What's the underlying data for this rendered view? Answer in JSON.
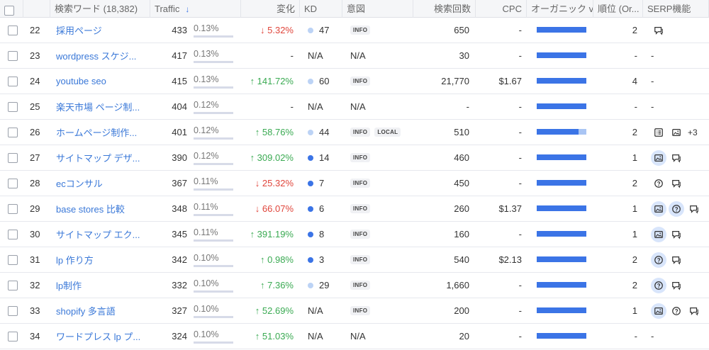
{
  "header": {
    "keyword": "検索ワード (18,382)",
    "traffic": "Traffic",
    "change": "変化",
    "kd": "KD",
    "intent": "意図",
    "volume": "検索回数",
    "cpc": "CPC",
    "organic": "オーガニック vs ",
    "position": "順位 (Or...",
    "serp": "SERP機能"
  },
  "rows": [
    {
      "num": "22",
      "keyword": "採用ページ",
      "traffic": "433",
      "share": "0.13%",
      "change": "↓ 5.32%",
      "dir": "dn",
      "kd_dot": "l",
      "kd": "47",
      "intent": [
        "INFO"
      ],
      "volume": "650",
      "cpc": "-",
      "organic": "full",
      "position": "2",
      "serp": [
        {
          "icon": "chat-icon",
          "hl": false
        }
      ],
      "more": ""
    },
    {
      "num": "23",
      "keyword": "wordpress スケジ...",
      "traffic": "417",
      "share": "0.13%",
      "change": "-",
      "dir": "",
      "kd_dot": "",
      "kd": "N/A",
      "intent_text": "N/A",
      "intent": [],
      "volume": "30",
      "cpc": "-",
      "organic": "full",
      "position": "-",
      "serp": [],
      "serp_text": "-",
      "more": ""
    },
    {
      "num": "24",
      "keyword": "youtube seo",
      "traffic": "415",
      "share": "0.13%",
      "change": "↑ 141.72%",
      "dir": "up",
      "kd_dot": "l",
      "kd": "60",
      "intent": [
        "INFO"
      ],
      "volume": "21,770",
      "cpc": "$1.67",
      "organic": "full",
      "position": "4",
      "serp": [],
      "serp_text": "-",
      "more": ""
    },
    {
      "num": "25",
      "keyword": "楽天市場 ページ制...",
      "traffic": "404",
      "share": "0.12%",
      "change": "-",
      "dir": "",
      "kd_dot": "",
      "kd": "N/A",
      "intent_text": "N/A",
      "intent": [],
      "volume": "-",
      "cpc": "-",
      "organic": "full",
      "position": "-",
      "serp": [],
      "serp_text": "-",
      "more": ""
    },
    {
      "num": "26",
      "keyword": "ホームページ制作...",
      "traffic": "401",
      "share": "0.12%",
      "change": "↑ 58.76%",
      "dir": "up",
      "kd_dot": "l",
      "kd": "44",
      "intent": [
        "INFO",
        "LOCAL"
      ],
      "volume": "510",
      "cpc": "-",
      "organic": "split",
      "position": "2",
      "serp": [
        {
          "icon": "list-icon",
          "hl": false
        },
        {
          "icon": "image-icon",
          "hl": false
        }
      ],
      "more": "+3"
    },
    {
      "num": "27",
      "keyword": "サイトマップ デザ...",
      "traffic": "390",
      "share": "0.12%",
      "change": "↑ 309.02%",
      "dir": "up",
      "kd_dot": "d",
      "kd": "14",
      "intent": [
        "INFO"
      ],
      "volume": "460",
      "cpc": "-",
      "organic": "full",
      "position": "1",
      "serp": [
        {
          "icon": "image-icon",
          "hl": true
        },
        {
          "icon": "chat-icon",
          "hl": false
        }
      ],
      "more": ""
    },
    {
      "num": "28",
      "keyword": "ecコンサル",
      "traffic": "367",
      "share": "0.11%",
      "change": "↓ 25.32%",
      "dir": "dn",
      "kd_dot": "d",
      "kd": "7",
      "intent": [
        "INFO"
      ],
      "volume": "450",
      "cpc": "-",
      "organic": "full",
      "position": "2",
      "serp": [
        {
          "icon": "question-icon",
          "hl": false
        },
        {
          "icon": "chat-icon",
          "hl": false
        }
      ],
      "more": ""
    },
    {
      "num": "29",
      "keyword": "base stores 比較",
      "traffic": "348",
      "share": "0.11%",
      "change": "↓ 66.07%",
      "dir": "dn",
      "kd_dot": "d",
      "kd": "6",
      "intent": [
        "INFO"
      ],
      "volume": "260",
      "cpc": "$1.37",
      "organic": "full",
      "position": "1",
      "serp": [
        {
          "icon": "image-icon",
          "hl": true
        },
        {
          "icon": "question-icon",
          "hl": true
        },
        {
          "icon": "chat-icon",
          "hl": false
        }
      ],
      "more": ""
    },
    {
      "num": "30",
      "keyword": "サイトマップ エク...",
      "traffic": "345",
      "share": "0.11%",
      "change": "↑ 391.19%",
      "dir": "up",
      "kd_dot": "d",
      "kd": "8",
      "intent": [
        "INFO"
      ],
      "volume": "160",
      "cpc": "-",
      "organic": "full",
      "position": "1",
      "serp": [
        {
          "icon": "image-icon",
          "hl": true
        },
        {
          "icon": "chat-icon",
          "hl": false
        }
      ],
      "more": ""
    },
    {
      "num": "31",
      "keyword": "lp 作り方",
      "traffic": "342",
      "share": "0.10%",
      "change": "↑ 0.98%",
      "dir": "up",
      "kd_dot": "d",
      "kd": "3",
      "intent": [
        "INFO"
      ],
      "volume": "540",
      "cpc": "$2.13",
      "organic": "full",
      "position": "2",
      "serp": [
        {
          "icon": "question-icon",
          "hl": true
        },
        {
          "icon": "chat-icon",
          "hl": false
        }
      ],
      "more": ""
    },
    {
      "num": "32",
      "keyword": "lp制作",
      "traffic": "332",
      "share": "0.10%",
      "change": "↑ 7.36%",
      "dir": "up",
      "kd_dot": "l",
      "kd": "29",
      "intent": [
        "INFO"
      ],
      "volume": "1,660",
      "cpc": "-",
      "organic": "full",
      "position": "2",
      "serp": [
        {
          "icon": "question-icon",
          "hl": true
        },
        {
          "icon": "chat-icon",
          "hl": false
        }
      ],
      "more": ""
    },
    {
      "num": "33",
      "keyword": "shopify 多言語",
      "traffic": "327",
      "share": "0.10%",
      "change": "↑ 52.69%",
      "dir": "up",
      "kd_dot": "",
      "kd": "N/A",
      "intent": [
        "INFO"
      ],
      "volume": "200",
      "cpc": "-",
      "organic": "full",
      "position": "1",
      "serp": [
        {
          "icon": "image-icon",
          "hl": true
        },
        {
          "icon": "question-icon",
          "hl": false
        },
        {
          "icon": "chat-icon",
          "hl": false
        }
      ],
      "more": ""
    },
    {
      "num": "34",
      "keyword": "ワードプレス lp プ...",
      "traffic": "324",
      "share": "0.10%",
      "change": "↑ 51.03%",
      "dir": "up",
      "kd_dot": "",
      "kd": "N/A",
      "intent_text": "N/A",
      "intent": [],
      "volume": "20",
      "cpc": "-",
      "organic": "full",
      "position": "-",
      "serp": [],
      "serp_text": "-",
      "more": ""
    }
  ],
  "colors": {
    "link": "#3a78d8",
    "up": "#3aaa52",
    "down": "#e0453b",
    "bar": "#3b74e6"
  }
}
